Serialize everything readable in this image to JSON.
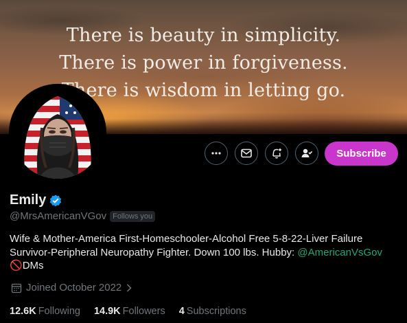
{
  "banner": {
    "quote_lines": [
      "There is beauty in simplicity.",
      "There is power in forgiveness.",
      "There is wisdom in letting go."
    ]
  },
  "actions": {
    "subscribe_label": "Subscribe"
  },
  "profile": {
    "name": "Emily",
    "handle": "@MrsAmericanVGov",
    "follows_you": "Follows you",
    "bio_line1": "Wife & Mother-America First-Homeschooler-Alcohol Free 5-8-22-Liver Failure",
    "bio_line2_text": "Survivor-Peripheral Neuropathy Fighter. Down 100 lbs. Hubby: ",
    "bio_mention": "@AmericanVsGov",
    "bio_line3_emoji": "🚫",
    "bio_line3_text": "DMs",
    "joined": "Joined October 2022"
  },
  "stats": {
    "following_count": "12.6K",
    "following_label": "Following",
    "followers_count": "14.9K",
    "followers_label": "Followers",
    "subscriptions_count": "4",
    "subscriptions_label": "Subscriptions"
  },
  "colors": {
    "subscribe_bg": "#c936cc",
    "mention": "#1fa876",
    "verified": "#1d9bf0",
    "muted_text": "#71767b"
  },
  "icons": {
    "more": "more-icon",
    "message": "message-icon",
    "notify": "bell-plus-icon",
    "following": "person-check-icon",
    "verified": "verified-badge-icon",
    "calendar": "calendar-icon",
    "chevron": "chevron-right-icon"
  }
}
